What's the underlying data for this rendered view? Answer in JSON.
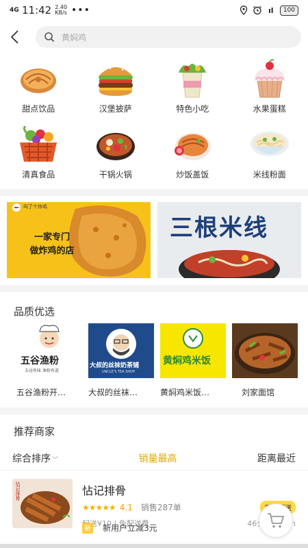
{
  "status": {
    "network": "4G",
    "network2": "ıl",
    "time": "11:42",
    "speed_value": "2.40",
    "speed_unit": "KB/s",
    "dots": "•••",
    "battery": "100"
  },
  "search": {
    "placeholder": "黄焖鸡"
  },
  "categories": [
    {
      "label": "甜点饮品"
    },
    {
      "label": "汉堡披萨"
    },
    {
      "label": "特色小吃"
    },
    {
      "label": "水果蛋糕"
    },
    {
      "label": "清真食品"
    },
    {
      "label": "干锅火锅"
    },
    {
      "label": "炒饭盖饭"
    },
    {
      "label": "米线粉面"
    }
  ],
  "banners": {
    "left": {
      "brand": "叫了个炸鸡",
      "line1": "一家专门",
      "line2": "做炸鸡的店"
    },
    "right": {
      "title": "三根米线"
    }
  },
  "quality": {
    "title": "品质优选",
    "items": [
      {
        "name": "五谷渔粉开…",
        "sign": "五谷渔粉",
        "sub": "五谷有味 渔粉有道"
      },
      {
        "name": "大叔的丝袜…",
        "sign": "大叔的丝袜奶茶铺",
        "sub": "UNCLE'S TEA SHOP"
      },
      {
        "name": "黄焖鸡米饭…",
        "sign": "黄焖鸡米饭"
      },
      {
        "name": "刘家面馆"
      }
    ]
  },
  "recommend": {
    "title": "推荐商家",
    "sort": {
      "composite": "综合排序",
      "sales": "销量最高",
      "distance": "距离最近"
    },
    "shop": {
      "name": "怗记排骨",
      "thumb_label": "怗记排骨",
      "stars": "★★★★★",
      "rating": "4.1",
      "sales": "销售287单",
      "tag": "平台配送",
      "delivery": "起送¥10 | 免配送费",
      "time_distance": "46分钟 | 3km",
      "promo_badge": "新",
      "promo_text": "新用户立减3元"
    }
  },
  "colors": {
    "accent": "#e0a800",
    "tag_bg": "#ffd84a",
    "banner_left": "#f6c21a"
  }
}
